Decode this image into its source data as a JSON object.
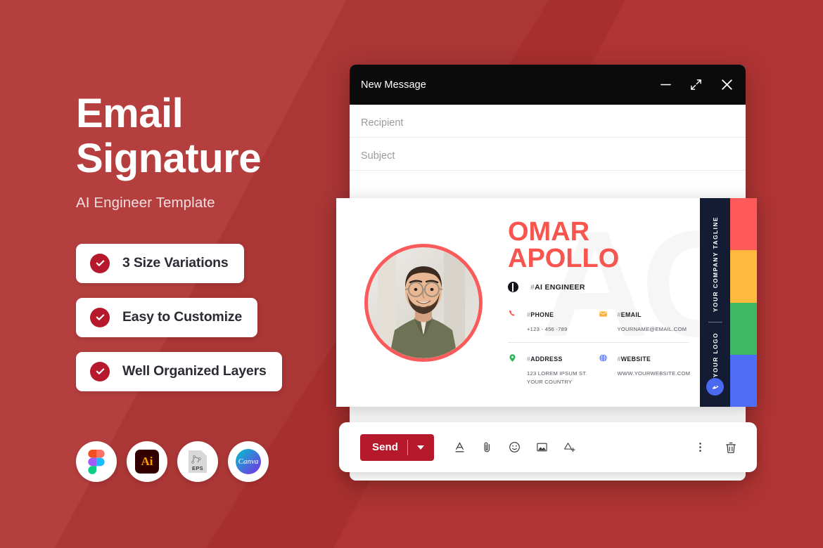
{
  "theme": {
    "background_red": "#AE3333",
    "accent_red": "#B5192B",
    "coral": "#F9554F",
    "navy": "#141C33"
  },
  "hero": {
    "title_line1": "Email",
    "title_line2": "Signature",
    "subtitle": "AI Engineer Template",
    "features": [
      {
        "label": "3 Size Variations",
        "icon": "check-circle-icon"
      },
      {
        "label": "Easy to Customize",
        "icon": "check-circle-icon"
      },
      {
        "label": "Well Organized Layers",
        "icon": "check-circle-icon"
      }
    ],
    "apps": [
      {
        "name": "figma-icon",
        "label": ""
      },
      {
        "name": "illustrator-icon",
        "label": "Ai"
      },
      {
        "name": "eps-file-icon",
        "label": "EPS"
      },
      {
        "name": "canva-icon",
        "label": "Canva"
      }
    ]
  },
  "mail_window": {
    "title": "New Message",
    "controls": [
      {
        "name": "minimize-icon",
        "label": "—"
      },
      {
        "name": "expand-icon",
        "label": "↗"
      },
      {
        "name": "close-icon",
        "label": "✕"
      }
    ],
    "fields": [
      {
        "name": "recipient-field",
        "placeholder": "Recipient",
        "value": ""
      },
      {
        "name": "subject-field",
        "placeholder": "Subject",
        "value": ""
      }
    ],
    "toolbar": {
      "send_label": "Send",
      "send_caret": "send-options-caret",
      "icons": [
        {
          "name": "format-text-icon",
          "title": "Formatting options"
        },
        {
          "name": "attach-file-icon",
          "title": "Attach files"
        },
        {
          "name": "insert-emoji-icon",
          "title": "Insert emoji"
        },
        {
          "name": "insert-photo-icon",
          "title": "Insert photo"
        },
        {
          "name": "insert-drive-icon",
          "title": "Insert files using Drive"
        }
      ],
      "right_icons": [
        {
          "name": "more-options-icon",
          "title": "More options"
        },
        {
          "name": "discard-draft-icon",
          "title": "Discard draft"
        }
      ]
    }
  },
  "signature": {
    "name": "OMAR APOLLO",
    "role_hash": "#",
    "role": "AI ENGINEER",
    "watermark": "AO",
    "contacts": [
      {
        "icon": "phone-icon",
        "icon_color": "#F9554F",
        "hash": "#",
        "label": "PHONE",
        "value": "+123 - 456 -789"
      },
      {
        "icon": "email-icon",
        "icon_color": "#FBB03B",
        "hash": "#",
        "label": "EMAIL",
        "value": "YOURNAME@EMAIL.COM"
      },
      {
        "icon": "location-pin-icon",
        "icon_color": "#2FB457",
        "hash": "#",
        "label": "ADDRESS",
        "value": "123 LOREM IPSUM ST.\nYOUR COUNTRY"
      },
      {
        "icon": "globe-icon",
        "icon_color": "#4A68F0",
        "hash": "#",
        "label": "WEBSITE",
        "value": "WWW.YOURWEBSITE.COM"
      }
    ],
    "side_panel": {
      "tagline": "YOUR COMPANY TAGLINE",
      "logo_label": "YOUR LOGO",
      "logo_icon": "circle-logo-icon"
    },
    "color_strip": [
      "#FF5A5A",
      "#FFB93E",
      "#3FB862",
      "#4E6CF5"
    ]
  }
}
